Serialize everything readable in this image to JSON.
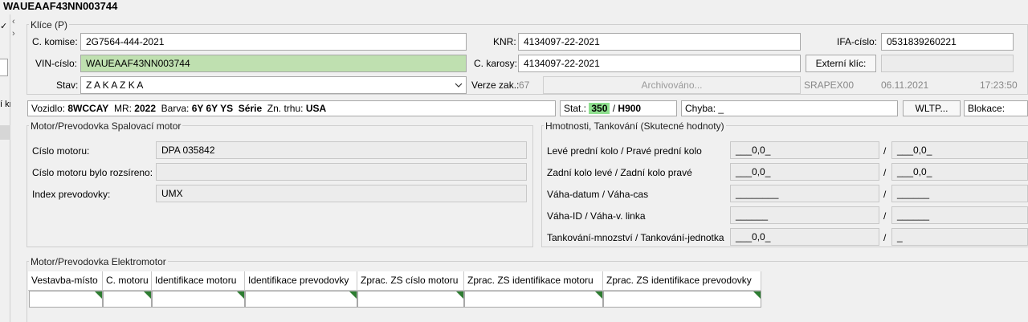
{
  "window": {
    "title": "WAUEAAF43NN003744"
  },
  "left_strip": {
    "check_glyph": "✓",
    "text": "í kr"
  },
  "klice": {
    "legend": "Klíce (P)",
    "komise_label": "C. komise:",
    "komise_value": "2G7564-444-2021",
    "knr_label": "KNR:",
    "knr_value": "4134097-22-2021",
    "ifa_label": "IFA-císlo:",
    "ifa_value": "0531839260221",
    "vin_label": "VIN-císlo:",
    "vin_value": "WAUEAAF43NN003744",
    "karosy_label": "C. karosy:",
    "karosy_value": "4134097-22-2021",
    "externi_button": "Externí klíc:",
    "externi_value": "",
    "stav_label": "Stav:",
    "stav_value": "Z A K A Z K A",
    "verze_label": "Verze zak.:",
    "verze_value": "67",
    "archiv_button": "Archivováno...",
    "user": "SRAPEX00",
    "date": "06.11.2021",
    "time": "17:23:50"
  },
  "info_bar": {
    "vozidlo_label": "Vozidlo:",
    "vozidlo_value": "8WCCAY",
    "mr_label": "MR:",
    "mr_value": "2022",
    "barva_label": "Barva:",
    "barva_value": "6Y 6Y YS",
    "serie_label": "Série",
    "trh_label": "Zn. trhu:",
    "trh_value": "USA",
    "stat_label": "Stat.:",
    "stat_value": "350",
    "stat_sep": "/",
    "stat_code": "H900",
    "chyba_label": "Chyba:",
    "chyba_value": "_",
    "wltp_button": "WLTP...",
    "blokace_label": "Blokace:"
  },
  "motor_spal": {
    "legend": "Motor/Prevodovka Spalovací motor",
    "rows": [
      {
        "label": "Císlo motoru:",
        "value": "DPA 035842"
      },
      {
        "label": "Císlo motoru bylo rozsíreno:",
        "value": ""
      },
      {
        "label": "Index prevodovky:",
        "value": "UMX"
      }
    ]
  },
  "hmotnosti": {
    "legend": "Hmotnosti, Tankování (Skutecné hodnoty)",
    "separator": "/",
    "rows": [
      {
        "label": "Levé prední kolo / Pravé prední kolo",
        "v1": "___0,0_",
        "v2": "___0,0_"
      },
      {
        "label": "Zadní kolo levé / Zadní kolo pravé",
        "v1": "___0,0_",
        "v2": "___0,0_"
      },
      {
        "label": "Váha-datum / Váha-cas",
        "v1": "________",
        "v2": "______"
      },
      {
        "label": "Váha-ID / Váha-v. linka",
        "v1": "______",
        "v2": "______"
      },
      {
        "label": "Tankování-mnozství / Tankování-jednotka",
        "v1": "___0,0_",
        "v2": "_"
      }
    ]
  },
  "elektromotor": {
    "legend": "Motor/Prevodovka Elektromotor",
    "columns": [
      "Vestavba-místo",
      "C. motoru",
      "Identifikace motoru",
      "Identifikace prevodovky",
      "Zprac. ZS císlo motoru",
      "Zprac. ZS identifikace motoru",
      "Zprac. ZS identifikace prevodovky"
    ]
  },
  "colors": {
    "vin_highlight": "#bfe0b0",
    "stat_highlight": "#8fe08f",
    "cell_marker": "#2e7d32"
  }
}
